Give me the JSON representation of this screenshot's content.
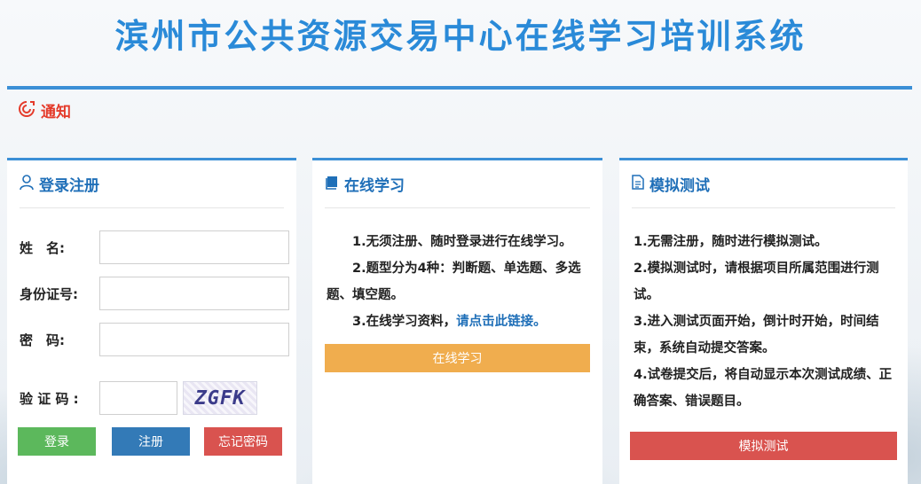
{
  "header": {
    "title": "滨州市公共资源交易中心在线学习培训系统"
  },
  "notice": {
    "label": "通知"
  },
  "login_panel": {
    "title": "登录注册",
    "fields": [
      {
        "label": "姓　名:",
        "value": ""
      },
      {
        "label": "身份证号:",
        "value": ""
      },
      {
        "label": "密　码:",
        "value": ""
      }
    ],
    "captcha_label": "验 证 码 :",
    "captcha_value": "",
    "captcha_text": "ZGFK",
    "buttons": {
      "login": "登录",
      "register": "注册",
      "forgot": "忘记密码"
    }
  },
  "study_panel": {
    "title": "在线学习",
    "lines": [
      "1.无须注册、随时登录进行在线学习。",
      "2.题型分为4种：判断题、单选题、多选题、填空题。"
    ],
    "line3_prefix": "3.在线学习资料，",
    "line3_link": "请点击此链接。",
    "button": "在线学习"
  },
  "test_panel": {
    "title": "模拟测试",
    "lines": [
      "1.无需注册，随时进行模拟测试。",
      "2.模拟测试时，请根据项目所属范围进行测试。",
      "3.进入测试页面开始，倒计时开始，时间结束，系统自动提交答案。",
      "4.试卷提交后，将自动显示本次测试成绩、正确答案、错误题目。"
    ],
    "button": "模拟测试"
  },
  "colors": {
    "accent": "#3b8fd6",
    "title": "#2a8ad8",
    "notice": "#e43b2b",
    "login_btn": "#5cb85c",
    "register_btn": "#337ab7",
    "forgot_btn": "#d9534f",
    "study_btn": "#f0ad4e",
    "test_btn": "#d9534f"
  }
}
